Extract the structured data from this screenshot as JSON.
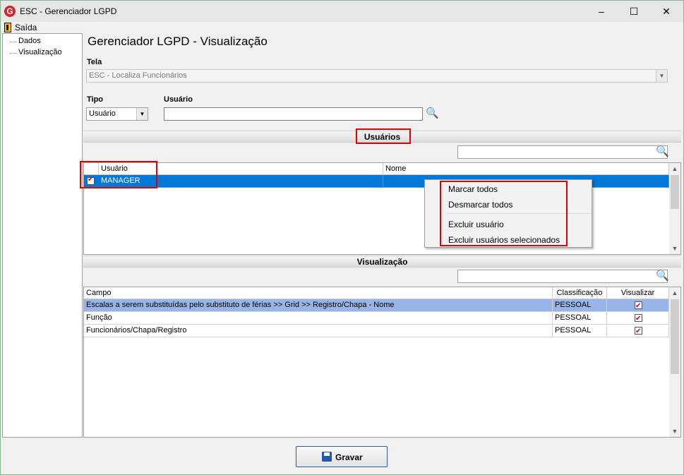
{
  "window": {
    "title": "ESC - Gerenciador LGPD",
    "icon_letter": "G",
    "minimize_glyph": "–",
    "maximize_glyph": "☐",
    "close_glyph": "✕"
  },
  "menu": {
    "exit_label": "Saída"
  },
  "tree": {
    "items": [
      "Dados",
      "Visualização"
    ]
  },
  "page": {
    "title": "Gerenciador LGPD - Visualização"
  },
  "tela": {
    "label": "Tela",
    "value": "ESC - Localiza Funcionários"
  },
  "tipo": {
    "label": "Tipo",
    "value": "Usuário"
  },
  "usuario_search": {
    "label": "Usuário",
    "value": ""
  },
  "users_section": {
    "title": "Usuários",
    "filter_value": "",
    "columns": [
      "Usuário",
      "Nome"
    ],
    "rows": [
      {
        "usuario": "MANAGER",
        "nome": "",
        "checked": true,
        "selected": true
      }
    ]
  },
  "context_menu": {
    "items": [
      "Marcar todos",
      "Desmarcar todos",
      "Excluir usuário",
      "Excluir usuários selecionados"
    ]
  },
  "view_section": {
    "title": "Visualização",
    "filter_value": "",
    "columns": [
      "Campo",
      "Classificação",
      "Visualizar"
    ],
    "rows": [
      {
        "campo": "Escalas a serem substituídas pelo substituto de férias >> Grid >> Registro/Chapa - Nome",
        "classificacao": "PESSOAL",
        "visualizar": true
      },
      {
        "campo": "Função",
        "classificacao": "PESSOAL",
        "visualizar": true
      },
      {
        "campo": "Funcionários/Chapa/Registro",
        "classificacao": "PESSOAL",
        "visualizar": true
      }
    ]
  },
  "save_button": {
    "label": "Gravar",
    "icon": "floppy-disk-icon"
  },
  "colors": {
    "selection": "#0078d7",
    "selection_light": "#99b4e6",
    "highlight_box": "#e00000",
    "check": "#d0021b"
  },
  "icons": {
    "search": "magnifier-icon",
    "search_symbol": "🔍"
  }
}
